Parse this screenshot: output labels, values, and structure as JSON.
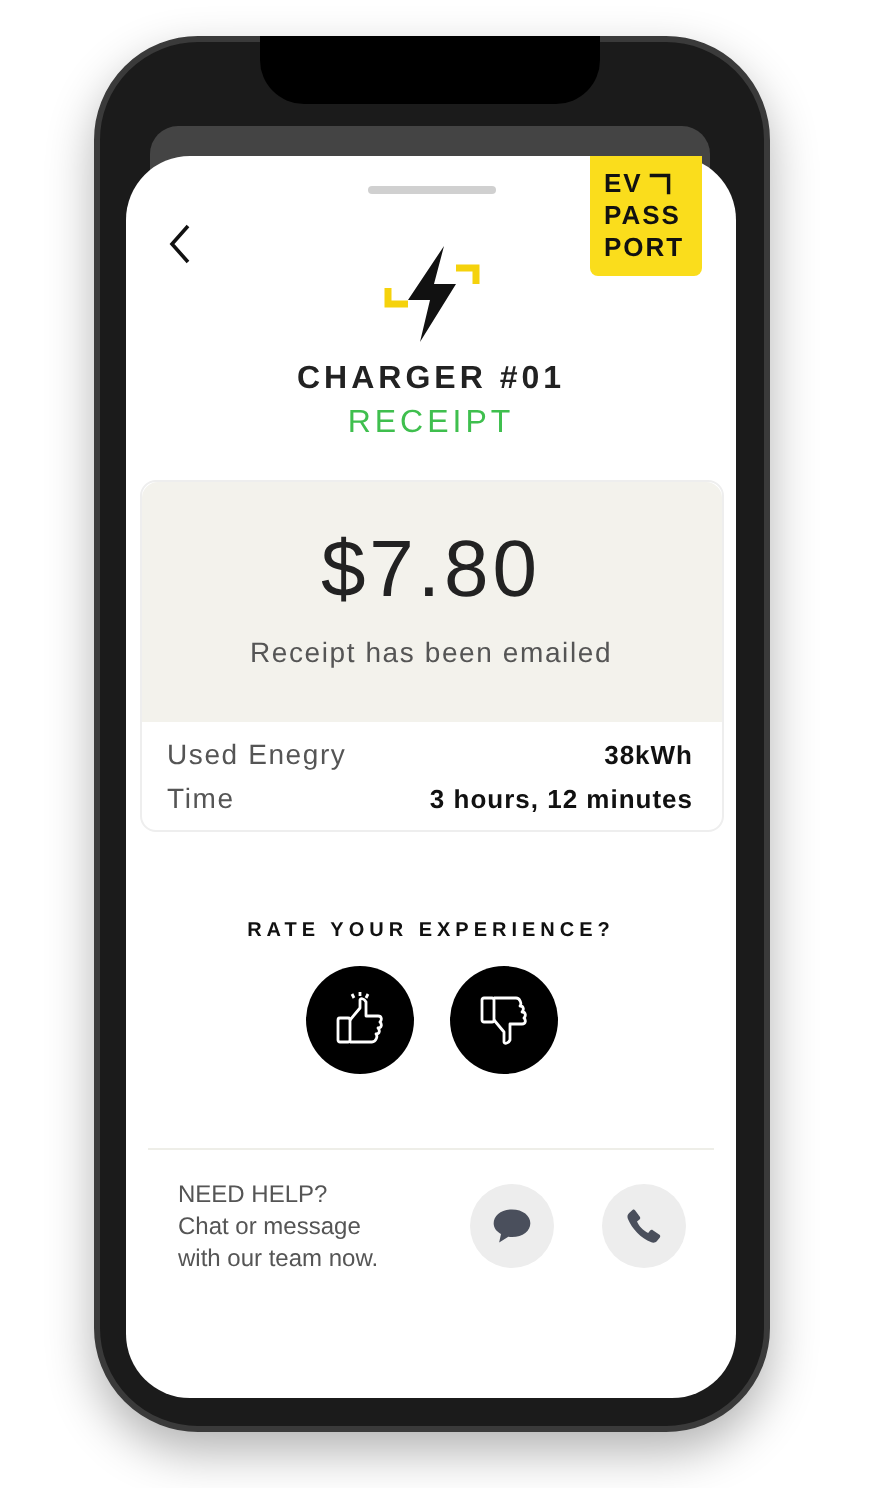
{
  "logo": {
    "lines": [
      "EV",
      "PASS",
      "PORT"
    ]
  },
  "charger": {
    "title": "CHARGER #01",
    "subtitle": "RECEIPT"
  },
  "receipt": {
    "amount": "$7.80",
    "note": "Receipt has been emailed"
  },
  "details": [
    {
      "label": "Used Enegry",
      "value": "38kWh"
    },
    {
      "label": "Time",
      "value": "3 hours, 12 minutes"
    }
  ],
  "rating": {
    "title": "RATE YOUR EXPERIENCE?",
    "options": [
      {
        "kind": "up"
      },
      {
        "kind": "down"
      }
    ]
  },
  "help": {
    "title": "NEED HELP?",
    "lines": [
      "Chat or message",
      "with our team now."
    ],
    "actions": [
      {
        "kind": "chat"
      },
      {
        "kind": "phone"
      }
    ]
  }
}
